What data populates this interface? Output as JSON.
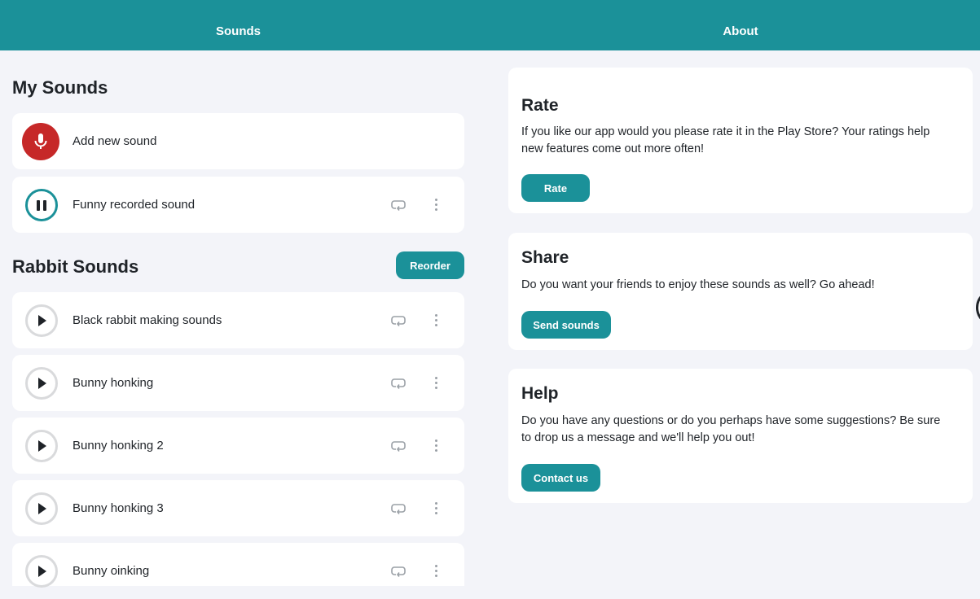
{
  "tabs": {
    "sounds": "Sounds",
    "about": "About"
  },
  "my_sounds": {
    "title": "My Sounds",
    "add_label": "Add new sound",
    "recorded": [
      {
        "label": "Funny recorded sound",
        "state": "playing"
      }
    ]
  },
  "rabbit_sounds": {
    "title": "Rabbit Sounds",
    "reorder_label": "Reorder",
    "items": [
      {
        "label": "Black rabbit making sounds"
      },
      {
        "label": "Bunny honking"
      },
      {
        "label": "Bunny honking 2"
      },
      {
        "label": "Bunny honking 3"
      },
      {
        "label": "Bunny oinking"
      }
    ]
  },
  "about": {
    "rate": {
      "title": "Rate",
      "text": "If you like our app would you please rate it in the Play Store? Your ratings help new features come out more often!",
      "button": "Rate"
    },
    "share": {
      "title": "Share",
      "text": "Do you want your friends to enjoy these sounds as well? Go ahead!",
      "button": "Send sounds"
    },
    "help": {
      "title": "Help",
      "text": "Do you have any questions or do you perhaps have some suggestions? Be sure to drop us a message and we'll help you out!",
      "button": "Contact us"
    }
  },
  "icons": {
    "mic": "microphone-icon",
    "play": "play-icon",
    "pause": "pause-icon",
    "loop": "loop-icon",
    "more": "more-vertical-icon"
  },
  "colors": {
    "accent": "#1b9199",
    "record": "#c62828",
    "background": "#f3f4f9"
  }
}
